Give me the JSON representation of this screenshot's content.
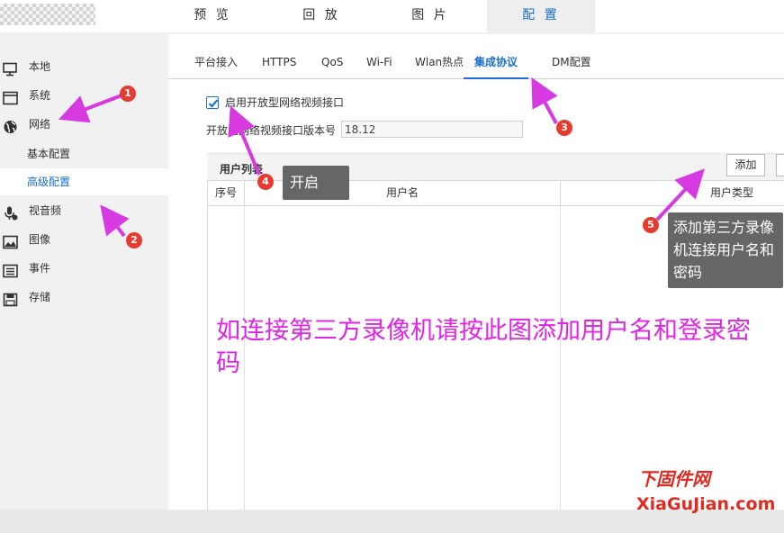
{
  "top_tabs": [
    {
      "label": "预 览"
    },
    {
      "label": "回 放"
    },
    {
      "label": "图 片"
    },
    {
      "label": "配 置",
      "active": true
    }
  ],
  "sidebar": {
    "items": [
      {
        "label": "本地",
        "icon": "monitor-icon"
      },
      {
        "label": "系统",
        "icon": "window-icon"
      },
      {
        "label": "网络",
        "icon": "globe-icon"
      },
      {
        "label": "视音频",
        "icon": "microphone-icon"
      },
      {
        "label": "图像",
        "icon": "image-icon"
      },
      {
        "label": "事件",
        "icon": "list-icon"
      },
      {
        "label": "存储",
        "icon": "floppy-icon"
      }
    ],
    "network_sub": [
      {
        "label": "基本配置"
      },
      {
        "label": "高级配置",
        "active": true
      }
    ]
  },
  "sub_tabs": [
    {
      "label": "平台接入"
    },
    {
      "label": "HTTPS"
    },
    {
      "label": "QoS"
    },
    {
      "label": "Wi-Fi"
    },
    {
      "label": "Wlan热点"
    },
    {
      "label": "集成协议",
      "active": true
    },
    {
      "label": "DM配置"
    }
  ],
  "form": {
    "enable_label": "启用开放型网络视频接口",
    "enable_checked": true,
    "version_label": "开放型网络视频接口版本号",
    "version_value": "18.12"
  },
  "user_table": {
    "title": "用户列表",
    "add_button": "添加",
    "columns": [
      "序号",
      "用户名",
      "用户类型"
    ],
    "rows": []
  },
  "annotations": {
    "badges": [
      "1",
      "2",
      "3",
      "4",
      "5"
    ],
    "tip4": "开启",
    "tip5": "添加第三方录像机连接用户名和密码",
    "overlay": "如连接第三方录像机请按此图添加用户名和登录密码",
    "watermark_top": "下固件网",
    "watermark_bottom": "XiaGuJian.com"
  },
  "colors": {
    "accent": "#1a6fd0",
    "badge": "#e63b2e",
    "arrow": "#d63ae0",
    "overlay_text": "#e024e6",
    "watermark": "#e12a1f"
  }
}
